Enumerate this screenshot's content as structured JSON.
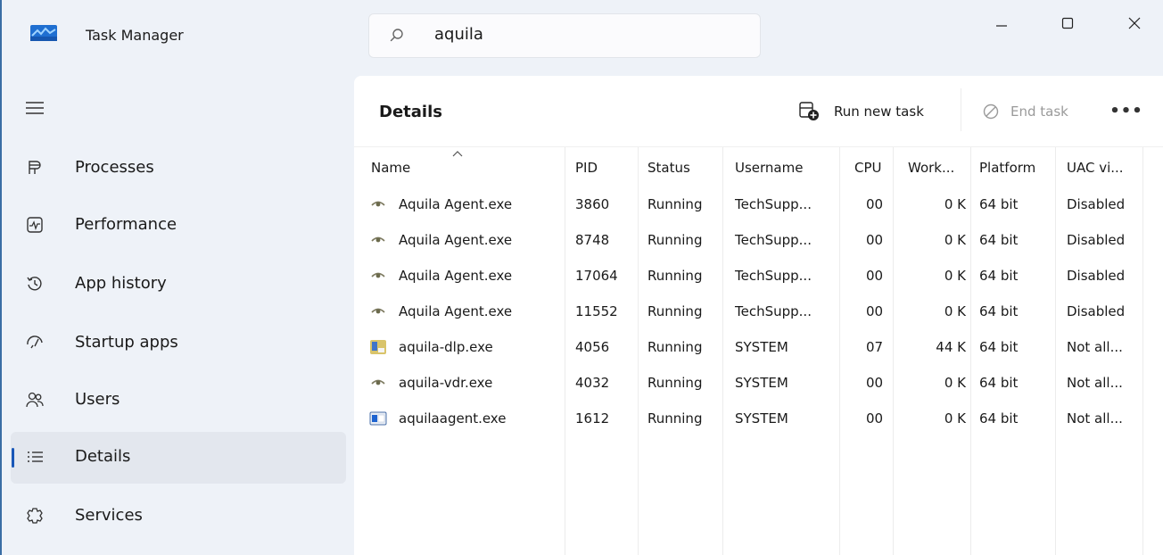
{
  "app": {
    "title": "Task Manager",
    "search_value": "aquila",
    "accent_color": "#1957b8"
  },
  "window_controls": {
    "minimize_icon": "minimize-icon",
    "maximize_icon": "maximize-icon",
    "close_icon": "close-icon"
  },
  "sidebar": {
    "menu_icon": "hamburger-icon",
    "selected": "Details",
    "items": [
      {
        "label": "Processes",
        "icon": "processes-icon"
      },
      {
        "label": "Performance",
        "icon": "performance-icon"
      },
      {
        "label": "App history",
        "icon": "app-history-icon"
      },
      {
        "label": "Startup apps",
        "icon": "startup-apps-icon"
      },
      {
        "label": "Users",
        "icon": "users-icon"
      },
      {
        "label": "Details",
        "icon": "details-icon"
      },
      {
        "label": "Services",
        "icon": "services-icon"
      }
    ]
  },
  "toolbar": {
    "page_title": "Details",
    "run_new_task": "Run new task",
    "end_task": "End task",
    "more_icon": "more-icon"
  },
  "table": {
    "sorted_column": "Name",
    "columns": [
      "Name",
      "PID",
      "Status",
      "Username",
      "CPU",
      "Work...",
      "Platform",
      "UAC vi..."
    ],
    "rows": [
      {
        "icon": "eye-icon",
        "name": "Aquila Agent.exe",
        "pid": "3860",
        "status": "Running",
        "username": "TechSupp...",
        "cpu": "00",
        "working_set": "0 K",
        "platform": "64 bit",
        "uac": "Disabled"
      },
      {
        "icon": "eye-icon",
        "name": "Aquila Agent.exe",
        "pid": "8748",
        "status": "Running",
        "username": "TechSupp...",
        "cpu": "00",
        "working_set": "0 K",
        "platform": "64 bit",
        "uac": "Disabled"
      },
      {
        "icon": "eye-icon",
        "name": "Aquila Agent.exe",
        "pid": "17064",
        "status": "Running",
        "username": "TechSupp...",
        "cpu": "00",
        "working_set": "0 K",
        "platform": "64 bit",
        "uac": "Disabled"
      },
      {
        "icon": "eye-icon",
        "name": "Aquila Agent.exe",
        "pid": "11552",
        "status": "Running",
        "username": "TechSupp...",
        "cpu": "00",
        "working_set": "0 K",
        "platform": "64 bit",
        "uac": "Disabled"
      },
      {
        "icon": "dlp-app-icon",
        "name": "aquila-dlp.exe",
        "pid": "4056",
        "status": "Running",
        "username": "SYSTEM",
        "cpu": "07",
        "working_set": "44 K",
        "platform": "64 bit",
        "uac": "Not all..."
      },
      {
        "icon": "eye-icon",
        "name": "aquila-vdr.exe",
        "pid": "4032",
        "status": "Running",
        "username": "SYSTEM",
        "cpu": "00",
        "working_set": "0 K",
        "platform": "64 bit",
        "uac": "Not all..."
      },
      {
        "icon": "window-app-icon",
        "name": "aquilaagent.exe",
        "pid": "1612",
        "status": "Running",
        "username": "SYSTEM",
        "cpu": "00",
        "working_set": "0 K",
        "platform": "64 bit",
        "uac": "Not all..."
      }
    ]
  }
}
